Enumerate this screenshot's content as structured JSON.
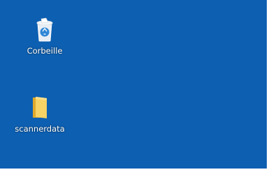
{
  "desktop": {
    "background": "#0d5fb1",
    "icons": [
      {
        "label": "Corbeille",
        "icon": "recycle-bin-icon"
      },
      {
        "label": "scannerdata",
        "icon": "folder-icon"
      }
    ]
  }
}
